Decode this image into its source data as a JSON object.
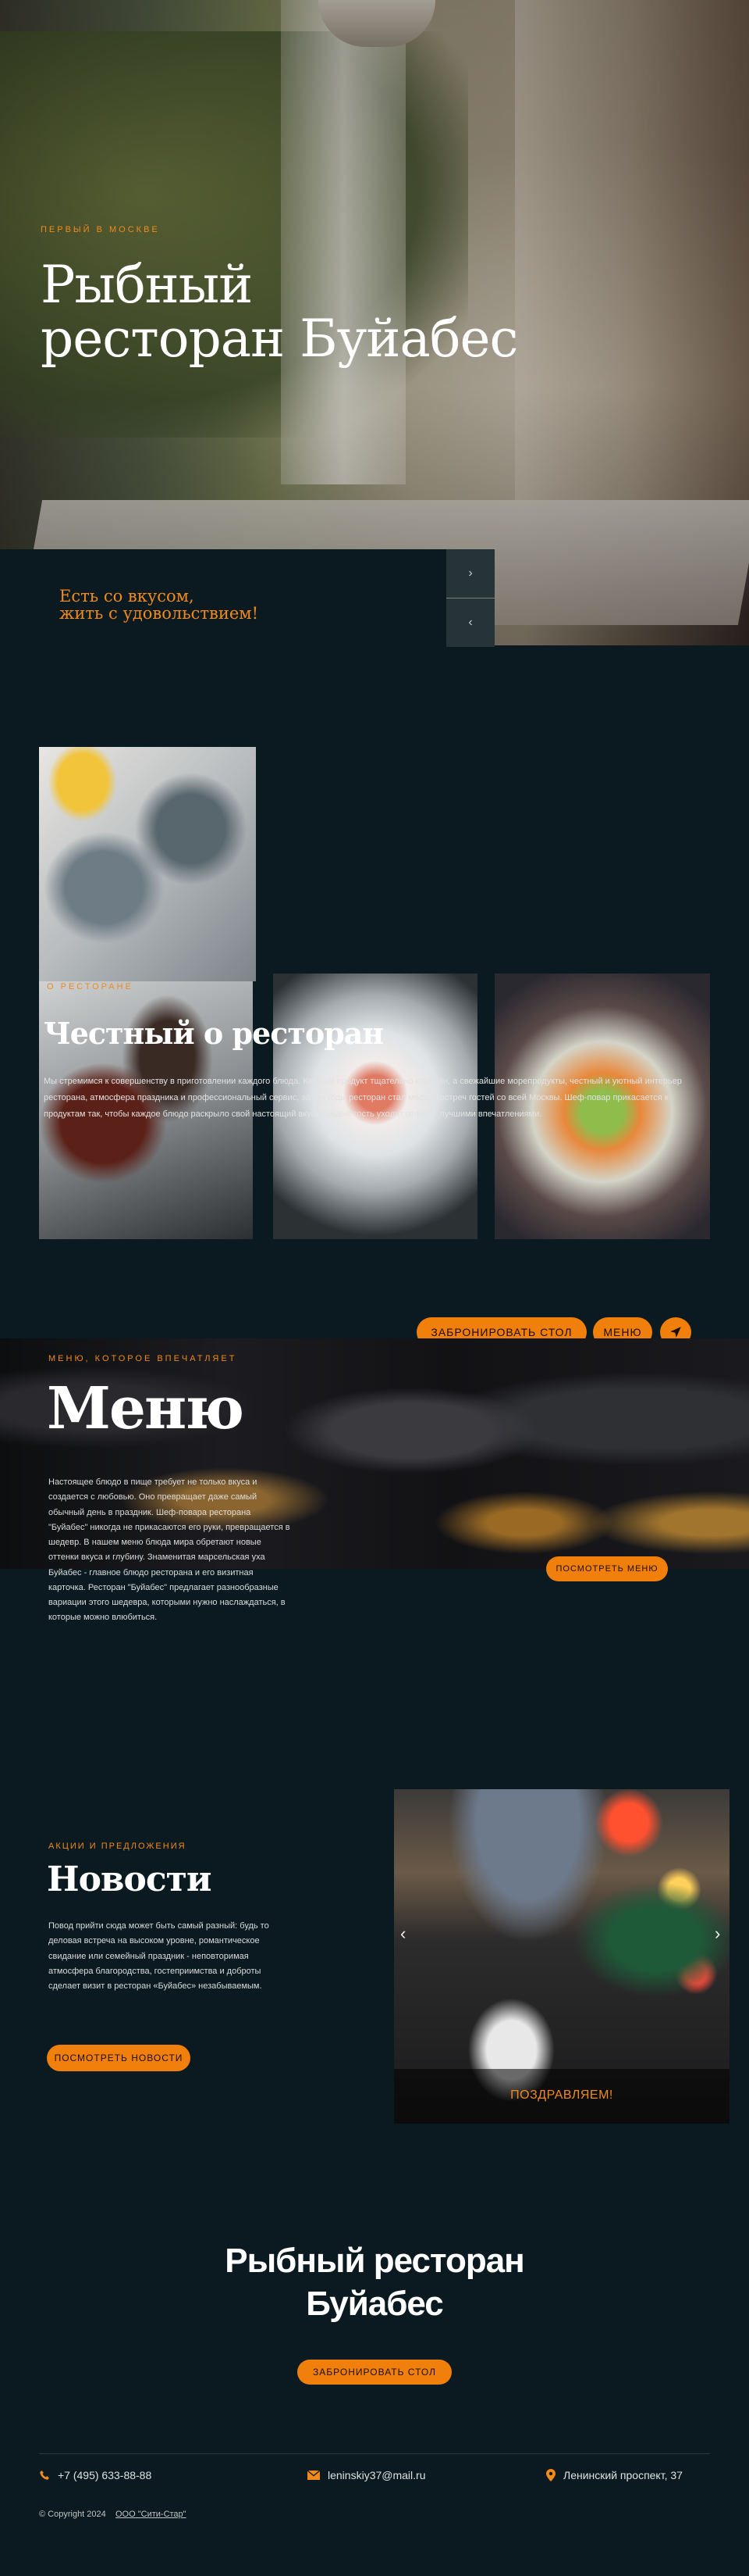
{
  "hero": {
    "eyebrow": "Первый в Москве",
    "title_line1": "Рыбный",
    "title_line2": "ресторан Буйабес",
    "slogan_line1": "Есть со вкусом,",
    "slogan_line2": "жить с удовольствием!",
    "next_arrow": "›",
    "prev_arrow": "‹"
  },
  "about": {
    "eyebrow": "о ресторане",
    "title": "Честный о ресторан",
    "text": "Мы стремимся к совершенству в приготовлении каждого блюда. Каждый продукт тщательно отобран, а свежайшие морепродукты, честный и уютный интерьер ресторана, атмосфера праздника и профессиональный сервис, за эти годы ресторан стал местом встреч гостей со всей Москвы. Шеф-повар прикасается к продуктам так, чтобы каждое блюдо раскрыло свой настоящий вкус. Каждый гость уходит от нас с лучшими впечатлениями."
  },
  "menu_bar": {
    "book_label": "Забронировать стол",
    "menu_label": "Меню",
    "nav_icon": "navigation-arrow-icon"
  },
  "menu": {
    "eyebrow": "Меню, которое впечатляет",
    "title": "Меню",
    "text": "Настоящее блюдо в пище требует не только вкуса и создается с любовью. Оно превращает даже самый обычный день в праздник. Шеф-повара ресторана \"Буйабес\" никогда не прикасаются его руки, превращается в шедевр. В нашем меню блюда мира обретают новые оттенки вкуса и глубину. Знаменитая марсельская уха Буйабес - главное блюдо ресторана и его визитная карточка. Ресторан \"Буйабес\" предлагает разнообразные вариации этого шедевра, которыми нужно наслаждаться, в которые можно влюбиться.",
    "button": "Посмотреть меню"
  },
  "news": {
    "eyebrow": "Акции и предложения",
    "title": "Новости",
    "text": "Повод прийти сюда может быть самый разный: будь то деловая встреча на высоком уровне, романтическое свидание или семейный праздник - неповторимая атмосфера благородства, гостеприимства и доброты сделает визит в ресторан «Буйабес» незабываемым.",
    "button": "Посмотреть новости",
    "slide_caption": "Поздравляем!",
    "prev": "‹",
    "next": "›"
  },
  "cta": {
    "title_line1": "Рыбный ресторан",
    "title_line2": "Буйабес",
    "button": "Забронировать стол"
  },
  "footer": {
    "phone": "+7 (495) 633-88-88",
    "email": "leninskiy37@mail.ru",
    "address": "Ленинский проспект, 37",
    "copyright": "© Copyright 2024",
    "company": "ООО \"Сити-Стар\""
  },
  "colors": {
    "background": "#0b1a20",
    "accent": "#f08a1c"
  }
}
